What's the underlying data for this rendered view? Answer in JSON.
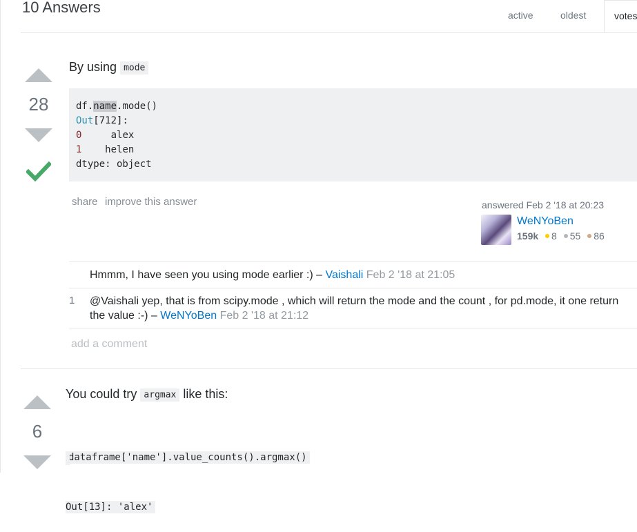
{
  "header": {
    "answers_count": "10 Answers",
    "tabs": [
      {
        "label": "active"
      },
      {
        "label": "oldest"
      },
      {
        "label": "votes"
      }
    ]
  },
  "answer1": {
    "votes": "28",
    "accepted": true,
    "text_before": "By using",
    "inline_code": "mode",
    "code_lines": {
      "l1_a": "df.",
      "l1_hl": "name",
      "l1_b": ".mode()",
      "l2_out": "Out",
      "l2_rest": "[712]:",
      "l3_idx": "0",
      "l3_val": "     alex",
      "l4_idx": "1",
      "l4_val": "    helen",
      "l5": "dtype: object"
    },
    "menu": {
      "share": "share",
      "improve": "improve this answer"
    },
    "user": {
      "answered": "answered Feb 2 '18 at 20:23",
      "name": "WeNYoBen",
      "rep": "159k",
      "gold": "8",
      "silver": "55",
      "bronze": "86"
    },
    "comments": [
      {
        "score": "",
        "text": "Hmmm, I have seen you using mode earlier :) –",
        "author": "Vaishali",
        "date": "Feb 2 '18 at 21:05"
      },
      {
        "score": "1",
        "text": "@Vaishali yep, that is from scipy.mode , which will return the mode and the count , for pd.mode, it one return the value :-) –",
        "author": "WeNYoBen",
        "date": "Feb 2 '18 at 21:12"
      }
    ],
    "add_comment": "add a comment"
  },
  "answer2": {
    "votes": "6",
    "text_before": "You could try",
    "inline_code": "argmax",
    "text_after": "like this:",
    "code_line1": "dataframe['name'].value_counts().argmax()",
    "code_line2": "Out[13]: 'alex'"
  },
  "colors": {
    "link": "#0077cc",
    "accepted_check": "#48a868",
    "gold": "#ffcc01",
    "silver": "#b4b8bc",
    "bronze": "#d1a684"
  }
}
